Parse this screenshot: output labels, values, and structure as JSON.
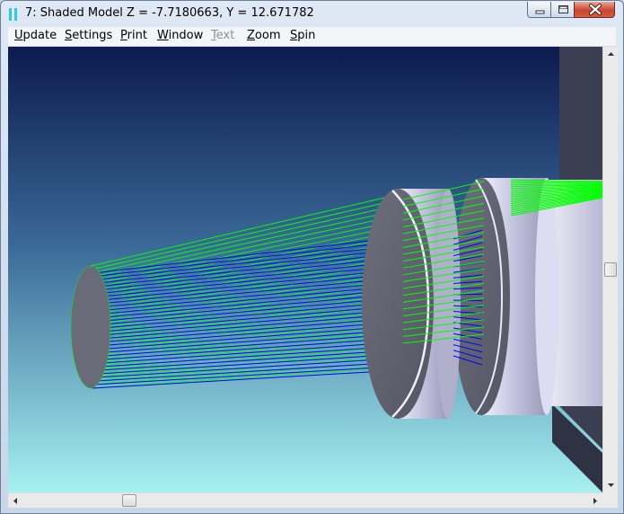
{
  "window": {
    "title": "7: Shaded Model Z = -7.7180663, Y = 12.671782"
  },
  "menu": {
    "items": [
      {
        "mnemonic": "U",
        "rest": "pdate",
        "enabled": true
      },
      {
        "mnemonic": "S",
        "rest": "ettings",
        "enabled": true
      },
      {
        "mnemonic": "P",
        "rest": "rint",
        "enabled": true
      },
      {
        "mnemonic": "W",
        "rest": "indow",
        "enabled": true
      },
      {
        "mnemonic": "T",
        "rest": "ext",
        "enabled": false
      },
      {
        "mnemonic": "Z",
        "rest": "oom",
        "enabled": true
      },
      {
        "mnemonic": "S",
        "rest": "pin",
        "enabled": true
      }
    ]
  },
  "scene": {
    "background_top": "#0c1a4f",
    "background_bottom": "#a6f1f1",
    "ray_colors": [
      "#00ff00",
      "#0000ff"
    ],
    "lens_color": "#c8c8e8",
    "housing_color": "#3c3f52"
  },
  "icons": {
    "app": "app-icon",
    "minimize": "minimize-icon",
    "maximize": "maximize-icon",
    "close": "close-icon"
  }
}
